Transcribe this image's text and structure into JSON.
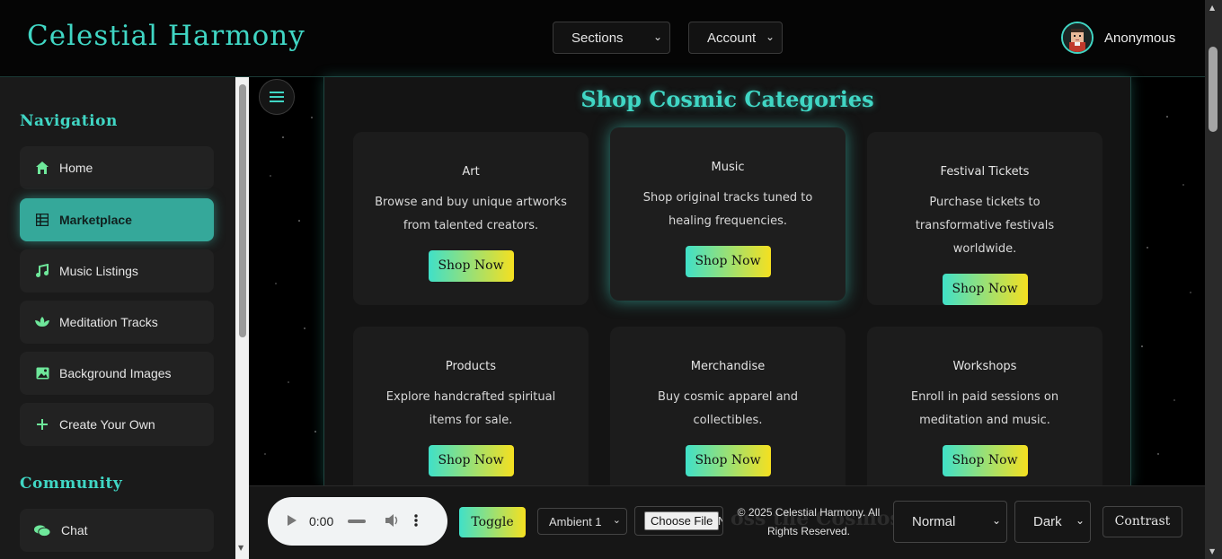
{
  "header": {
    "brand": "Celestial Harmony",
    "sections_select": "Sections",
    "account_select": "Account",
    "username": "Anonymous"
  },
  "sidebar": {
    "nav_heading": "Navigation",
    "items": [
      {
        "label": "Home",
        "icon": "home-icon"
      },
      {
        "label": "Marketplace",
        "icon": "grid-icon",
        "active": true
      },
      {
        "label": "Music Listings",
        "icon": "music-note-icon"
      },
      {
        "label": "Meditation Tracks",
        "icon": "lotus-icon"
      },
      {
        "label": "Background Images",
        "icon": "image-icon"
      },
      {
        "label": "Create Your Own",
        "icon": "plus-icon"
      }
    ],
    "community_heading": "Community",
    "community_items": [
      {
        "label": "Chat",
        "icon": "chat-icon"
      }
    ]
  },
  "main": {
    "title": "Shop Cosmic Categories",
    "cards": [
      {
        "title": "Art",
        "desc": "Browse and buy unique artworks from talented creators.",
        "button": "Shop Now"
      },
      {
        "title": "Music",
        "desc": "Shop original tracks tuned to healing frequencies.",
        "button": "Shop Now"
      },
      {
        "title": "Festival Tickets",
        "desc": "Purchase tickets to transformative festivals worldwide.",
        "button": "Shop Now"
      },
      {
        "title": "Products",
        "desc": "Explore handcrafted spiritual items for sale.",
        "button": "Shop Now"
      },
      {
        "title": "Merchandise",
        "desc": "Buy cosmic apparel and collectibles.",
        "button": "Shop Now"
      },
      {
        "title": "Workshops",
        "desc": "Enroll in paid sessions on meditation and music.",
        "button": "Shop Now"
      }
    ]
  },
  "footer": {
    "audio_time": "0:00",
    "toggle_label": "Toggle",
    "ambient_select": "Ambient 1",
    "file_button": "Choose File",
    "file_trailing": "N",
    "ghost_text": "oss the Cosmos",
    "copyright": "© 2025 Celestial Harmony. All Rights Reserved.",
    "mode_select": "Normal",
    "theme_select": "Dark",
    "contrast_label": "Contrast"
  },
  "colors": {
    "accent": "#40d6c4",
    "active_item": "#35a89a",
    "gradient_start": "#40e0c8",
    "gradient_end": "#f5e020"
  }
}
